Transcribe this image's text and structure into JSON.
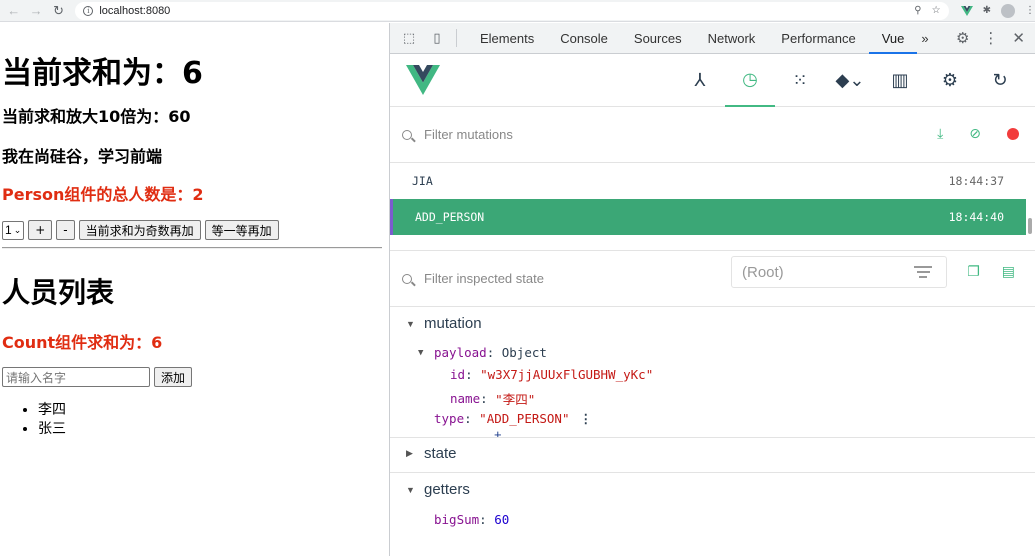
{
  "browser": {
    "url": "localhost:8080"
  },
  "app": {
    "sum_text": "当前求和为：6",
    "big_sum_text": "当前求和放大10倍为：60",
    "school_text": "我在尚硅谷，学习前端",
    "person_total_text": "Person组件的总人数是：2",
    "select_value": "1",
    "buttons": {
      "plus": "+",
      "minus": "-",
      "odd_add": "当前求和为奇数再加",
      "wait_add": "等一等再加"
    },
    "list_title": "人员列表",
    "count_sum_text": "Count组件求和为：6",
    "name_placeholder": "请输入名字",
    "add_button": "添加",
    "persons": [
      "李四",
      "张三"
    ]
  },
  "devtools": {
    "tabs": [
      "Elements",
      "Console",
      "Sources",
      "Network",
      "Performance",
      "Vue"
    ],
    "active_tab": "Vue",
    "more_tabs": "»",
    "filter_mutations_placeholder": "Filter mutations",
    "mutations": [
      {
        "name": "JIA",
        "time": "18:44:37"
      },
      {
        "name": "ADD_PERSON",
        "time": "18:44:40"
      }
    ],
    "filter_state_placeholder": "Filter inspected state",
    "root_selector": "(Root)",
    "mutation_section": "mutation",
    "payload_key": "payload",
    "payload_type": "Object",
    "id_key": "id",
    "id_value": "\"w3X7jjAUUxFlGUBHW_yKc\"",
    "name_key": "name",
    "name_value": "\"李四\"",
    "type_key": "type",
    "type_value": "\"ADD_PERSON\"",
    "state_section": "state",
    "getters_section": "getters",
    "bigsum_key": "bigSum",
    "bigsum_value": "60"
  },
  "colors": {
    "vue_green": "#42b983",
    "active_row": "#3ba776",
    "red_text": "#e02d12",
    "record_dot": "#f23c3c"
  }
}
